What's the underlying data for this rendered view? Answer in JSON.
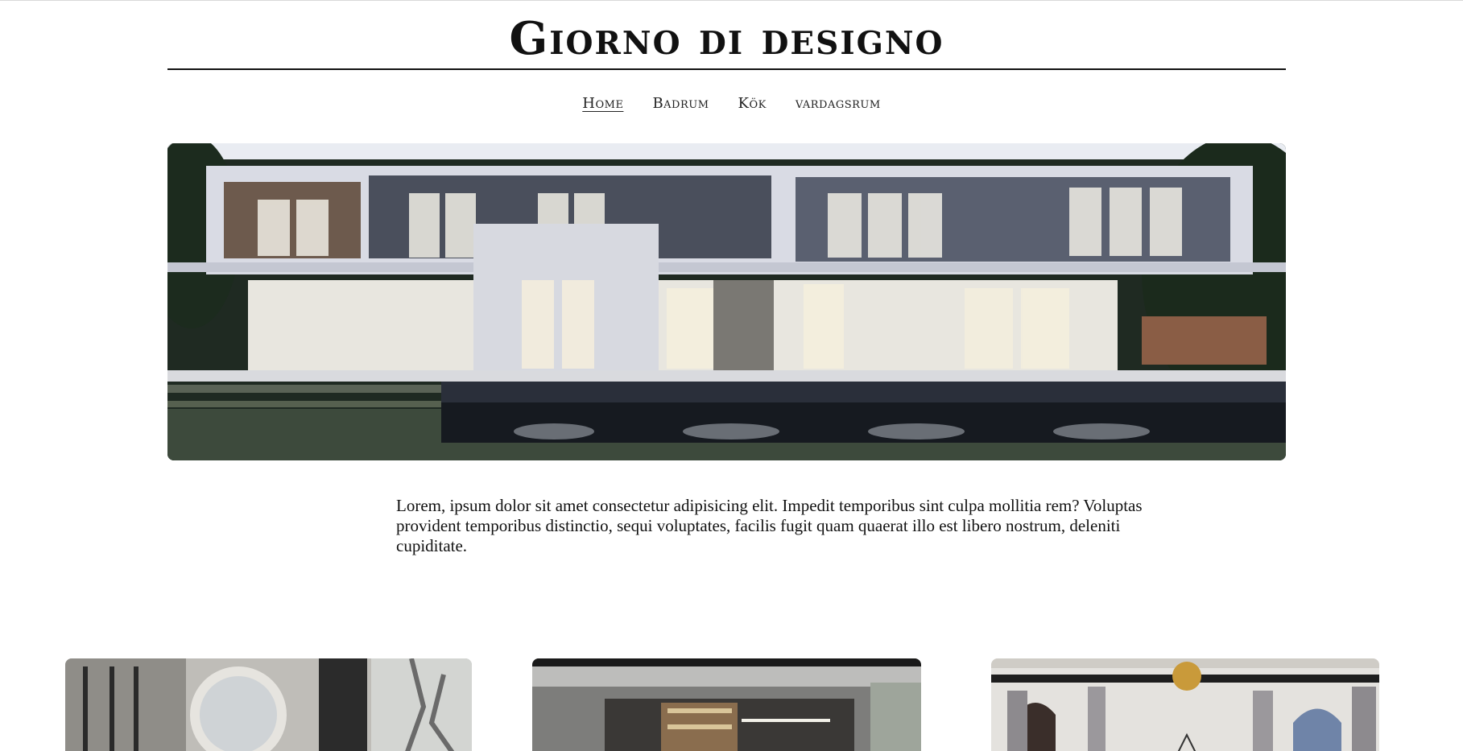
{
  "site": {
    "title": "Giorno di designo"
  },
  "nav": {
    "items": [
      {
        "label": "Home",
        "active": true
      },
      {
        "label": "Badrum",
        "active": false
      },
      {
        "label": "Kök",
        "active": false
      },
      {
        "label": "vardagsrum",
        "active": false
      }
    ]
  },
  "hero": {
    "image": "modern-villa-night-photo"
  },
  "intro": {
    "text": "Lorem, ipsum dolor sit amet consectetur adipisicing elit. Impedit temporibus sint culpa mollitia rem? Voluptas provident temporibus distinctio, sequi voluptates, facilis fugit quam quaerat illo est libero nostrum, deleniti cupiditate."
  },
  "cards": [
    {
      "image": "bathroom-photo"
    },
    {
      "image": "kitchen-photo"
    },
    {
      "image": "living-room-photo"
    }
  ]
}
